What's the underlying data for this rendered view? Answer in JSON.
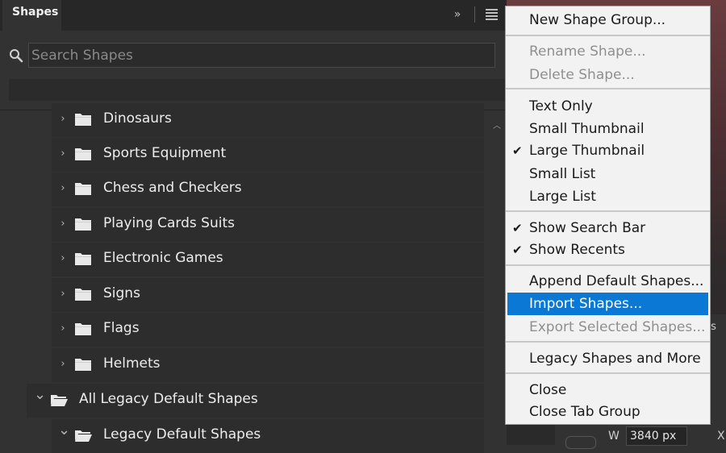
{
  "panel": {
    "tab_label": "Shapes",
    "collapse_glyph": "»",
    "search_placeholder": "Search Shapes"
  },
  "tree": [
    {
      "label": "Dinosaurs",
      "expanded": false,
      "level": 1
    },
    {
      "label": "Sports Equipment",
      "expanded": false,
      "level": 1
    },
    {
      "label": "Chess and Checkers",
      "expanded": false,
      "level": 1
    },
    {
      "label": "Playing Cards Suits",
      "expanded": false,
      "level": 1
    },
    {
      "label": "Electronic Games",
      "expanded": false,
      "level": 1
    },
    {
      "label": "Signs",
      "expanded": false,
      "level": 1
    },
    {
      "label": "Flags",
      "expanded": false,
      "level": 1
    },
    {
      "label": "Helmets",
      "expanded": false,
      "level": 1
    },
    {
      "label": "All Legacy Default Shapes",
      "expanded": true,
      "level": 0
    },
    {
      "label": "Legacy Default Shapes",
      "expanded": true,
      "level": 1
    }
  ],
  "menu": {
    "items": [
      {
        "label": "New Shape Group...",
        "enabled": true,
        "checked": false
      },
      {
        "label": "Rename Shape...",
        "enabled": false,
        "checked": false
      },
      {
        "label": "Delete Shape...",
        "enabled": false,
        "checked": false
      },
      {
        "label": "Text Only",
        "enabled": true,
        "checked": false
      },
      {
        "label": "Small Thumbnail",
        "enabled": true,
        "checked": false
      },
      {
        "label": "Large Thumbnail",
        "enabled": true,
        "checked": true
      },
      {
        "label": "Small List",
        "enabled": true,
        "checked": false
      },
      {
        "label": "Large List",
        "enabled": true,
        "checked": false
      },
      {
        "label": "Show Search Bar",
        "enabled": true,
        "checked": true
      },
      {
        "label": "Show Recents",
        "enabled": true,
        "checked": true
      },
      {
        "label": "Append Default Shapes...",
        "enabled": true,
        "checked": false
      },
      {
        "label": "Import Shapes...",
        "enabled": true,
        "checked": false,
        "highlighted": true
      },
      {
        "label": "Export Selected Shapes...",
        "enabled": false,
        "checked": false
      },
      {
        "label": "Legacy Shapes and More",
        "enabled": true,
        "checked": false
      },
      {
        "label": "Close",
        "enabled": true,
        "checked": false
      },
      {
        "label": "Close Tab Group",
        "enabled": true,
        "checked": false
      }
    ],
    "check_glyph": "✔"
  },
  "properties": {
    "tab_fragment": "ts",
    "width_label": "W",
    "width_value": "3840 px",
    "x_label": "X"
  },
  "colors": {
    "panel_bg": "#323232",
    "menu_bg": "#f2f2f2",
    "highlight": "#0a78d4"
  }
}
